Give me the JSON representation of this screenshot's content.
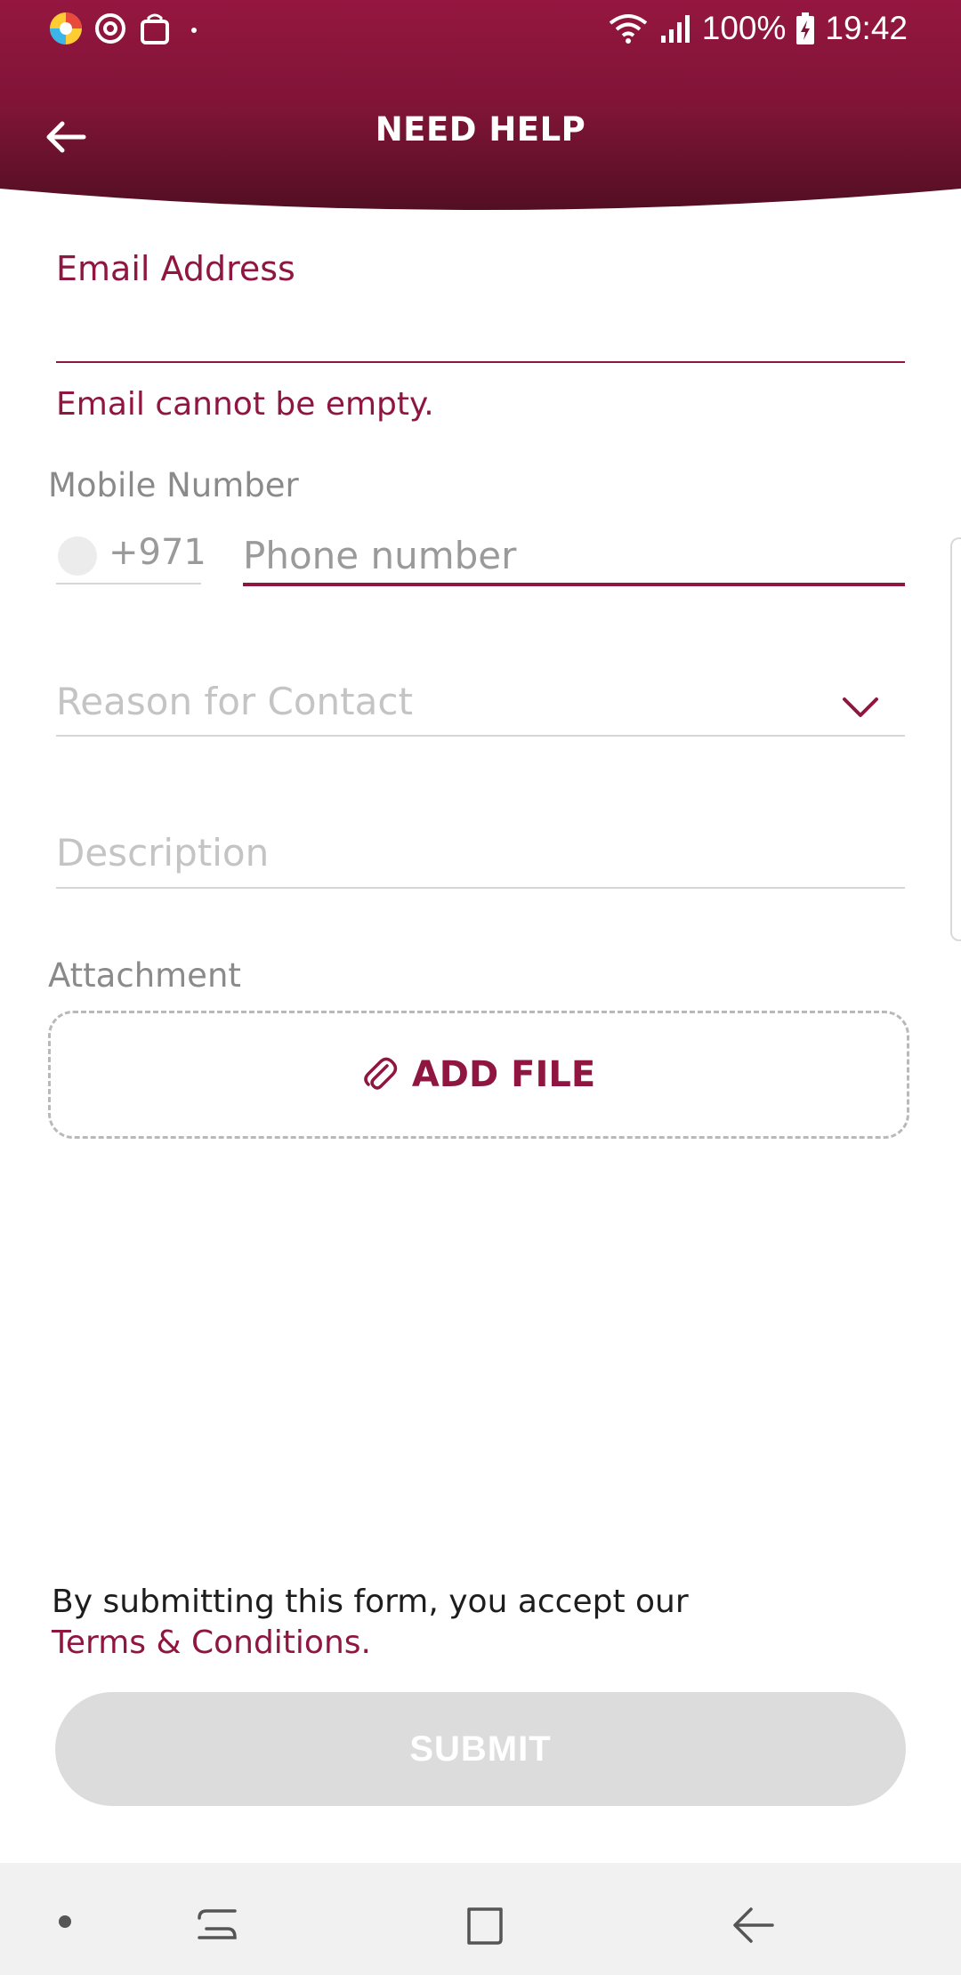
{
  "status_bar": {
    "battery": "100%",
    "time": "19:42"
  },
  "header": {
    "title": "NEED HELP"
  },
  "form": {
    "email": {
      "label": "Email Address",
      "value": "",
      "error": "Email cannot be empty."
    },
    "mobile": {
      "label": "Mobile Number",
      "country_code": "+971",
      "placeholder": "Phone number",
      "value": ""
    },
    "reason": {
      "placeholder": "Reason for Contact"
    },
    "description": {
      "placeholder": "Description"
    },
    "attachment": {
      "label": "Attachment",
      "button_label": "ADD FILE"
    }
  },
  "footer": {
    "terms_text": "By submitting this form, you accept our",
    "terms_link": "Terms & Conditions.",
    "submit_label": "SUBMIT"
  },
  "colors": {
    "brand": "#8f1640",
    "header_dark": "#4f0e22",
    "disabled_button": "#dcdcdc"
  },
  "icons": {
    "back": "arrow-left-icon",
    "dropdown": "chevron-down-icon",
    "attach": "paperclip-icon"
  }
}
